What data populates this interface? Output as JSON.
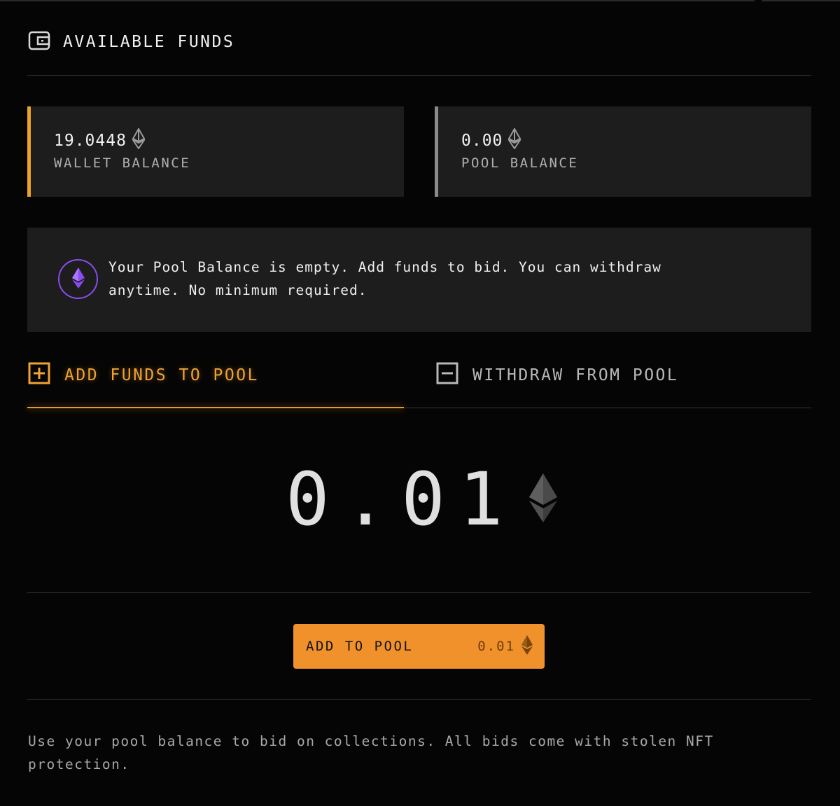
{
  "header": {
    "title": "AVAILABLE FUNDS",
    "icon": "wallet-icon"
  },
  "cards": {
    "wallet": {
      "amount": "19.0448",
      "label": "WALLET BALANCE",
      "accent": "#e8a32b"
    },
    "pool": {
      "amount": "0.00",
      "label": "POOL BALANCE",
      "accent": "#8a8a8a"
    }
  },
  "notice": {
    "text": "Your Pool Balance is empty. Add funds to bid. You can withdraw anytime. No minimum required.",
    "icon": "eth-icon",
    "accent": "#8b4cf0"
  },
  "tabs": [
    {
      "label": "ADD FUNDS TO POOL",
      "icon": "plus-square-icon",
      "active": true
    },
    {
      "label": "WITHDRAW FROM POOL",
      "icon": "minus-square-icon",
      "active": false
    }
  ],
  "amount_input": {
    "value": "0.01",
    "currency_icon": "eth-icon"
  },
  "action_button": {
    "label": "ADD TO POOL",
    "value": "0.01",
    "color": "#f0912c"
  },
  "footer": {
    "text": "Use your pool balance to bid on collections. All bids come with stolen NFT protection."
  }
}
